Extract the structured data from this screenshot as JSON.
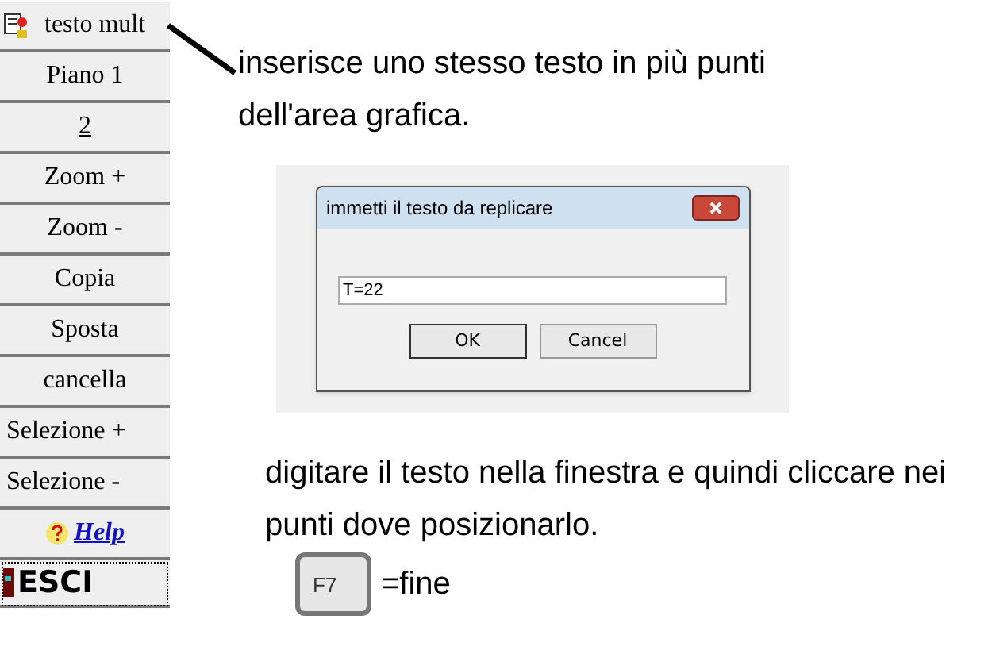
{
  "toolbar": [
    {
      "kind": "icon",
      "label": "testo mult"
    },
    {
      "kind": "center",
      "label": "Piano 1"
    },
    {
      "kind": "underlined",
      "label": "2"
    },
    {
      "kind": "center",
      "label": "Zoom +"
    },
    {
      "kind": "center",
      "label": "Zoom -"
    },
    {
      "kind": "center",
      "label": "Copia"
    },
    {
      "kind": "center",
      "label": "Sposta"
    },
    {
      "kind": "center",
      "label": "cancella"
    },
    {
      "kind": "left",
      "label": "Selezione +"
    },
    {
      "kind": "left",
      "label": "Selezione -"
    },
    {
      "kind": "help",
      "label": "Help"
    },
    {
      "kind": "exit",
      "label": "ESCI"
    }
  ],
  "description": "inserisce uno stesso testo in più punti dell'area grafica.",
  "dialog": {
    "title": "immetti il testo da replicare",
    "value": "T=22",
    "buttons": [
      "OK",
      "Cancel"
    ]
  },
  "instruction": "digitare il testo nella finestra e quindi cliccare nei punti dove posizionarlo.",
  "key": {
    "label": "F7",
    "meaning": "=fine"
  }
}
